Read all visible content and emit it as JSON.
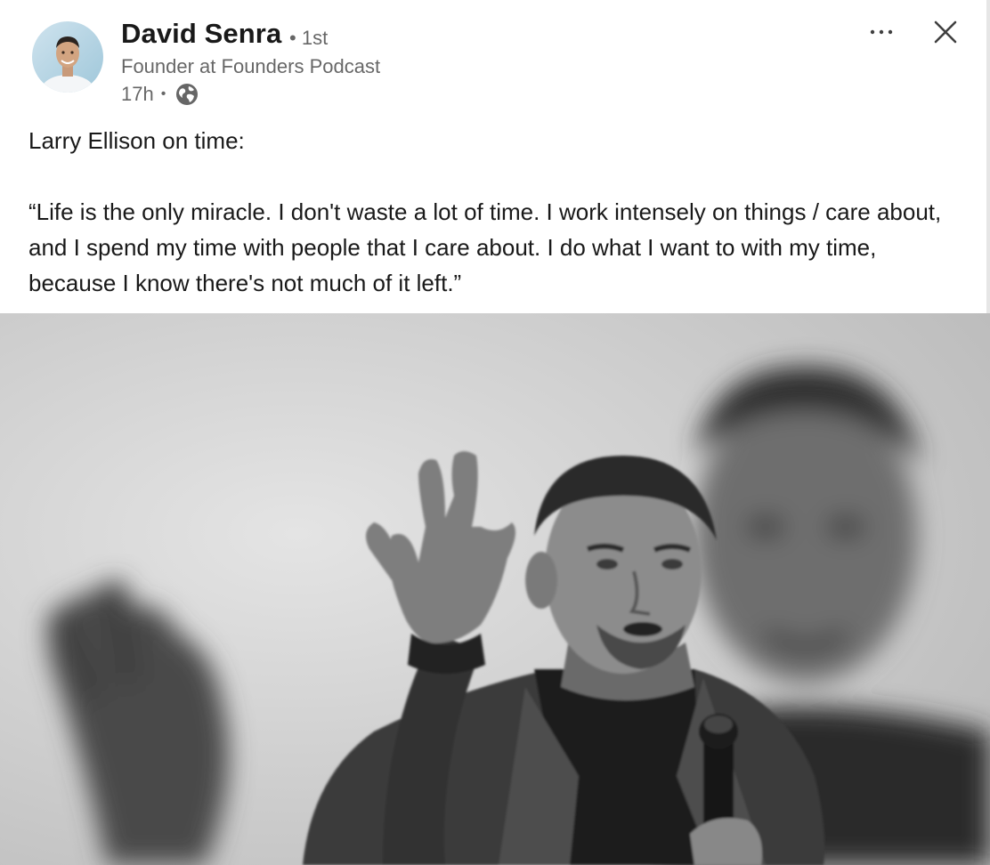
{
  "post": {
    "author": {
      "name": "David Senra",
      "degree": "1st",
      "headline": "Founder at Founders Podcast",
      "time": "17h",
      "separator": "•",
      "visibility_icon": "globe-icon",
      "avatar_icon": "profile-photo"
    },
    "controls": {
      "more_icon": "ellipsis-icon",
      "close_icon": "close-icon"
    },
    "text": "Larry Ellison on time:\n\n“Life is the only miracle. I don't waste a lot of time. I work intensely on things / care about, and I spend my time with people that I care about. I do what I want to with my time, because I know there's not much of it left.”",
    "image": {
      "description_icon": "photo",
      "palette": {
        "background": "#d6d6d6",
        "jacket": "#3a3a3a",
        "shirt": "#1e1e1e",
        "skin": "#8c8c8c"
      }
    }
  }
}
